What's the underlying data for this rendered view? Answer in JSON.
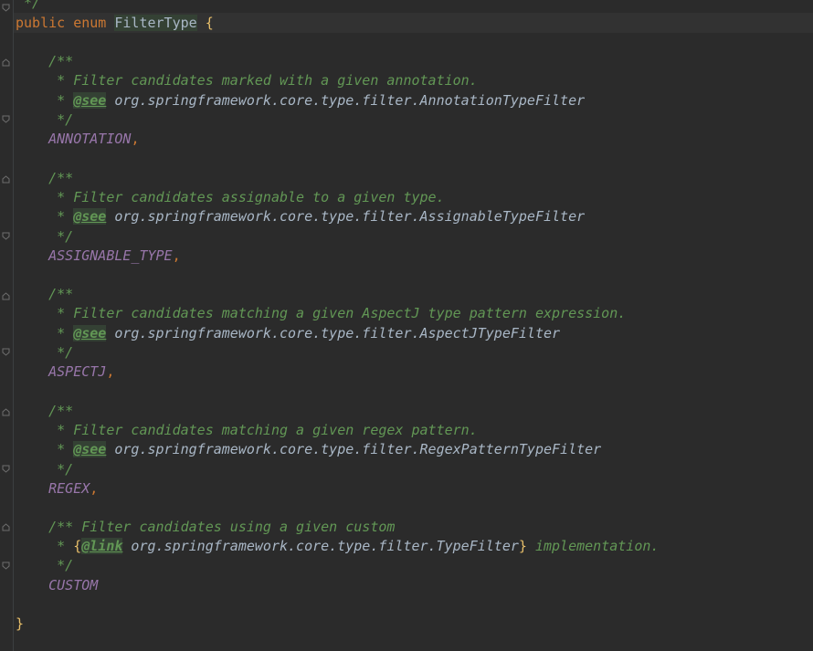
{
  "code": {
    "top_comment_end": " */",
    "decl": {
      "kw_public": "public",
      "kw_enum": "enum",
      "name": "FilterType",
      "open_brace": "{",
      "close_brace": "}"
    },
    "entries": [
      {
        "doc_open": "/**",
        "desc": " * Filter candidates marked with a given annotation.",
        "see_prefix": " * ",
        "see_tag": "@see",
        "see_ref": " org.springframework.core.type.filter.AnnotationTypeFilter",
        "doc_close": " */",
        "constant": "ANNOTATION",
        "sep": ","
      },
      {
        "doc_open": "/**",
        "desc": " * Filter candidates assignable to a given type.",
        "see_prefix": " * ",
        "see_tag": "@see",
        "see_ref": " org.springframework.core.type.filter.AssignableTypeFilter",
        "doc_close": " */",
        "constant": "ASSIGNABLE_TYPE",
        "sep": ","
      },
      {
        "doc_open": "/**",
        "desc": " * Filter candidates matching a given AspectJ type pattern expression.",
        "see_prefix": " * ",
        "see_tag": "@see",
        "see_ref": " org.springframework.core.type.filter.AspectJTypeFilter",
        "doc_close": " */",
        "constant": "ASPECTJ",
        "sep": ","
      },
      {
        "doc_open": "/**",
        "desc": " * Filter candidates matching a given regex pattern.",
        "see_prefix": " * ",
        "see_tag": "@see",
        "see_ref": " org.springframework.core.type.filter.RegexPatternTypeFilter",
        "doc_close": " */",
        "constant": "REGEX",
        "sep": ","
      }
    ],
    "last_entry": {
      "doc_line1": "/** Filter candidates using a given custom",
      "line2_prefix": " * ",
      "link_open": "{",
      "link_tag": "@link",
      "link_ref": " org.springframework.core.type.filter.TypeFilter",
      "link_close": "}",
      "line2_suffix": " implementation.",
      "doc_close": " */",
      "constant": "CUSTOM"
    }
  }
}
